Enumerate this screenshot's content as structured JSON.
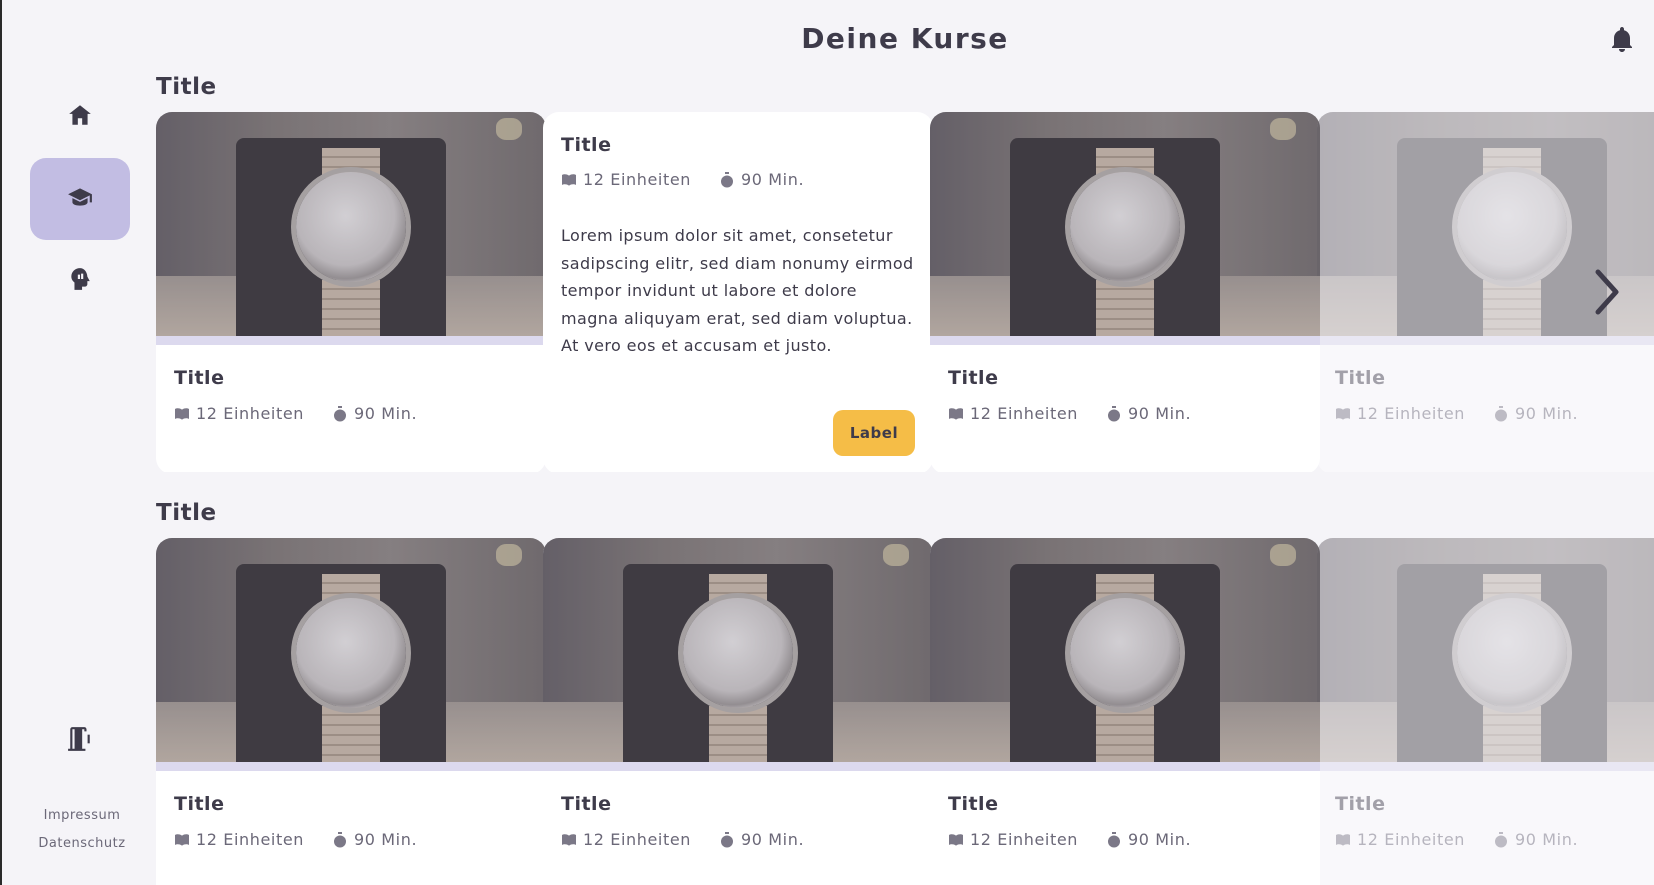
{
  "header": {
    "title": "Deine Kurse"
  },
  "sidebar": {
    "footer": {
      "impressum": "Impressum",
      "datenschutz": "Datenschutz"
    }
  },
  "sections": [
    {
      "title": "Title",
      "cards": [
        {
          "title": "Title",
          "units": "12 Einheiten",
          "duration": "90 Min."
        },
        {
          "title": "Title",
          "units": "12 Einheiten",
          "duration": "90 Min.",
          "description": "Lorem ipsum dolor sit amet, consetetur sadipscing elitr, sed diam nonumy eirmod tempor invidunt ut labore et dolore magna aliquyam erat, sed diam voluptua. At vero eos et accusam et justo.",
          "button_label": "Label"
        },
        {
          "title": "Title",
          "units": "12 Einheiten",
          "duration": "90 Min."
        },
        {
          "title": "Title",
          "units": "12 Einheiten",
          "duration": "90 Min."
        }
      ]
    },
    {
      "title": "Title",
      "cards": [
        {
          "title": "Title",
          "units": "12 Einheiten",
          "duration": "90 Min."
        },
        {
          "title": "Title",
          "units": "12 Einheiten",
          "duration": "90 Min."
        },
        {
          "title": "Title",
          "units": "12 Einheiten",
          "duration": "90 Min."
        },
        {
          "title": "Title",
          "units": "12 Einheiten",
          "duration": "90 Min."
        }
      ]
    }
  ],
  "colors": {
    "accent": "#c2bde3",
    "button": "#f5bd47",
    "background": "#f5f4f8",
    "text": "#3e3b4a"
  },
  "icons": [
    "home-icon",
    "graduation-cap-icon",
    "brain-head-icon",
    "exit-door-icon",
    "bell-icon",
    "book-icon",
    "stopwatch-icon",
    "chevron-right-icon"
  ]
}
